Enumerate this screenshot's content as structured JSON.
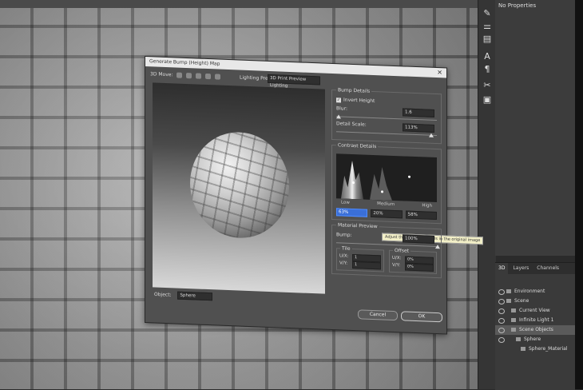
{
  "properties_panel": {
    "title": "No Properties"
  },
  "dialog": {
    "title": "Generate Bump (Height) Map",
    "move_label": "3D Move:",
    "lighting_label": "Lighting Preset:",
    "lighting_value": "3D Print Preview Lighting",
    "object_label": "Object:",
    "object_value": "Sphere",
    "bump_details": {
      "title": "Bump Details",
      "invert_label": "Invert Height",
      "blur_label": "Blur:",
      "blur_value": "1.6",
      "detail_scale_label": "Detail Scale:",
      "detail_scale_value": "113%"
    },
    "contrast": {
      "title": "Contrast Details",
      "low_label": "Low",
      "medium_label": "Medium",
      "high_label": "High",
      "tooltip": "Adjust the contrast details in the original image",
      "low_value": "63%",
      "medium_value": "20%",
      "high_value": "58%"
    },
    "material": {
      "title": "Material Preview",
      "bump_label": "Bump:",
      "bump_value": "100%",
      "tile_title": "Tile",
      "offset_title": "Offset",
      "u_label": "U/X:",
      "v_label": "V/Y:",
      "tile_u": "1",
      "tile_v": "1",
      "offset_u": "0%",
      "offset_v": "0%"
    },
    "cancel_label": "Cancel",
    "ok_label": "OK"
  },
  "panel3d": {
    "tabs": [
      "3D",
      "Layers",
      "Channels"
    ],
    "rows": [
      "Environment",
      "Scene",
      "Current View",
      "Infinite Light 1",
      "Scene Objects",
      "Sphere",
      "Sphere_Material"
    ]
  }
}
